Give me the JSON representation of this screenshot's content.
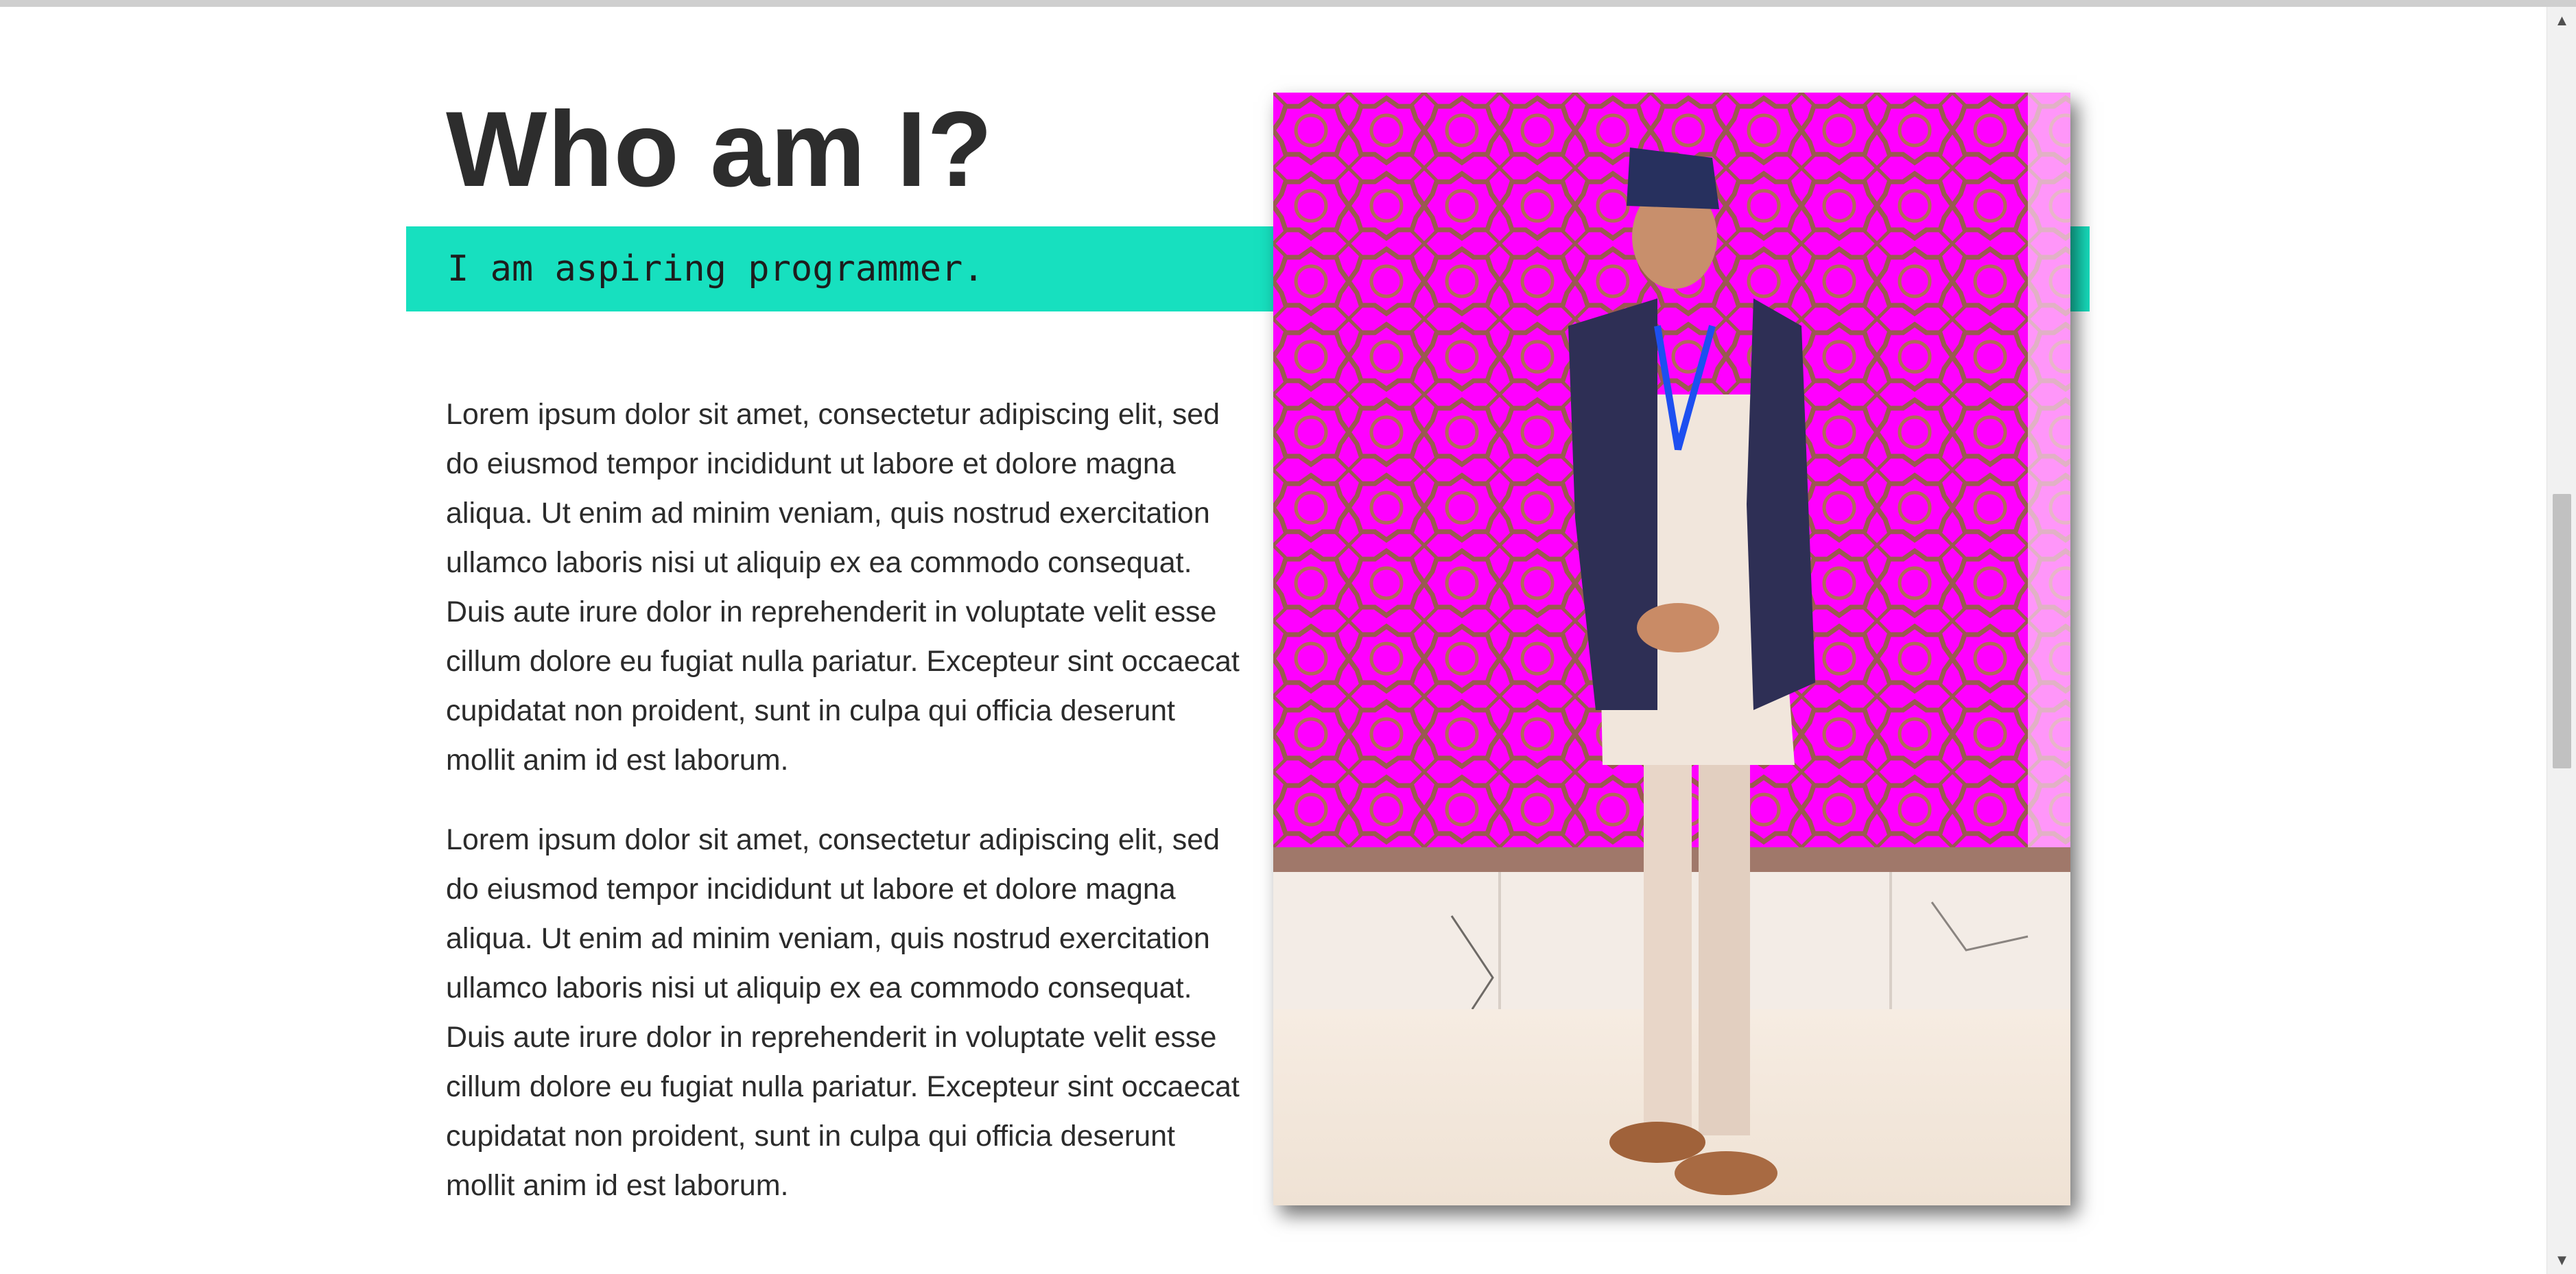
{
  "about": {
    "heading": "Who am I?",
    "tagline": "I am aspiring programmer.",
    "paragraphs": [
      "Lorem ipsum dolor sit amet, consectetur adipiscing elit, sed do eiusmod tempor incididunt ut labore et dolore magna aliqua. Ut enim ad minim veniam, quis nostrud exercitation ullamco laboris nisi ut aliquip ex ea commodo consequat. Duis aute irure dolor in reprehenderit in voluptate velit esse cillum dolore eu fugiat nulla pariatur. Excepteur sint occaecat cupidatat non proident, sunt in culpa qui officia deserunt mollit anim id est laborum.",
      "Lorem ipsum dolor sit amet, consectetur adipiscing elit, sed do eiusmod tempor incididunt ut labore et dolore magna aliqua. Ut enim ad minim veniam, quis nostrud exercitation ullamco laboris nisi ut aliquip ex ea commodo consequat. Duis aute irure dolor in reprehenderit in voluptate velit esse cillum dolore eu fugiat nulla pariatur. Excepteur sint occaecat cupidatat non proident, sunt in culpa qui officia deserunt mollit anim id est laborum."
    ]
  },
  "colors": {
    "accent_banner": "#17e0bf",
    "heading_text": "#2d2d2d",
    "photo_backdrop": "#ff00ff"
  },
  "scrollbar": {
    "up_icon": "scroll-up-arrow-icon",
    "down_icon": "scroll-down-arrow-icon",
    "up_glyph": "▲",
    "down_glyph": "▼"
  }
}
